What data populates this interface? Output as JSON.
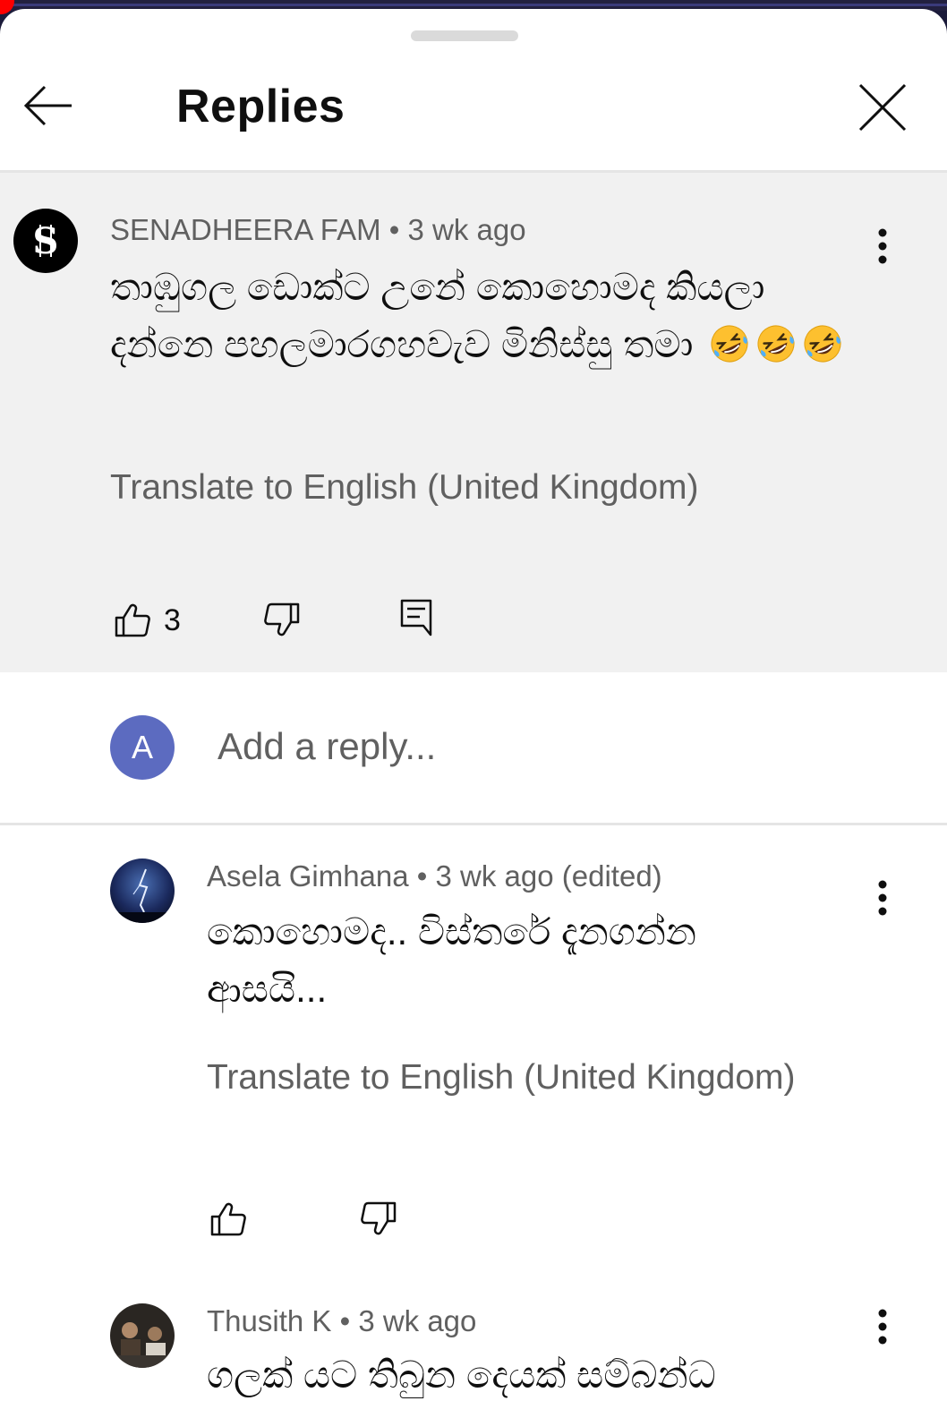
{
  "header": {
    "title": "Replies"
  },
  "parent_comment": {
    "author": "SENADHEERA FAM",
    "separator": "•",
    "time": "3 wk ago",
    "text": "තාඹුගල ඩොක්ට උනේ කොහොමද කියලා දන්නෙ පහලමාරගහවැව මිනිස්සු තමා",
    "emoji_count": 3,
    "translate_label": "Translate to English (United Kingdom)",
    "like_count": "3"
  },
  "reply_box": {
    "avatar_letter": "A",
    "placeholder": "Add a reply..."
  },
  "replies": [
    {
      "author": "Asela Gimhana",
      "separator": "•",
      "time": "3 wk ago (edited)",
      "text_line1": "කොහොමද.. විස්තරේ දැනගන්න",
      "text_line2": "ආසයි...",
      "translate_label": "Translate to English (United Kingdom)"
    },
    {
      "author": "Thusith K",
      "separator": "•",
      "time": "3 wk ago",
      "text_line1": "ගලක් යට තිබුන දෙයක් සම්බන්ධ"
    }
  ],
  "colors": {
    "parent_background": "#f1f1f1",
    "avatar_letter_background": "#5c6bc0",
    "meta_text": "#606060",
    "emoji_face": "#fdc02f"
  },
  "icons": [
    "back-arrow-icon",
    "close-icon",
    "more-vert-icon",
    "thumb-up-icon",
    "thumb-down-icon",
    "reply-icon",
    "rofl-emoji"
  ]
}
